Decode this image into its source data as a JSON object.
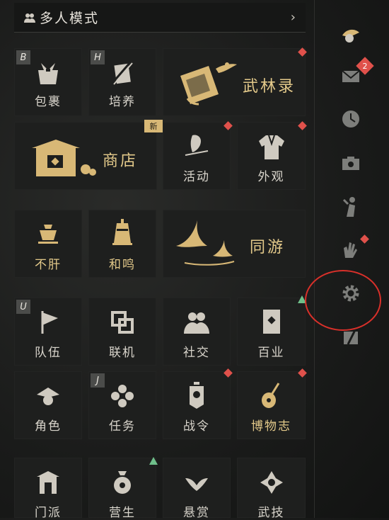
{
  "header": {
    "title": "多人模式",
    "arrow": "›"
  },
  "tiles": {
    "baoguo": {
      "label": "包裹",
      "key": "B"
    },
    "peiyang": {
      "label": "培养",
      "key": "H"
    },
    "wulinlu": {
      "label": "武林录"
    },
    "shangdian": {
      "label": "商店",
      "badge": "新"
    },
    "huodong": {
      "label": "活动"
    },
    "waiguan": {
      "label": "外观"
    },
    "bugan": {
      "label": "不肝"
    },
    "heming": {
      "label": "和鸣"
    },
    "tongyou": {
      "label": "同游"
    },
    "duiwu": {
      "label": "队伍",
      "key": "U"
    },
    "lianji": {
      "label": "联机"
    },
    "shejiao": {
      "label": "社交"
    },
    "baiye": {
      "label": "百业"
    },
    "juese": {
      "label": "角色"
    },
    "renwu": {
      "label": "任务",
      "key": "J"
    },
    "zhanling": {
      "label": "战令"
    },
    "bowuzhi": {
      "label": "博物志"
    },
    "r6a": {
      "label": "门派"
    },
    "r6b": {
      "label": "营生"
    },
    "r6c": {
      "label": "悬赏"
    },
    "r6d": {
      "label": "武技"
    }
  },
  "sidebar": {
    "mail_count": "2"
  },
  "colors": {
    "accent_gold": "#e3c98a",
    "red_dot": "#e0514b",
    "green_tri": "#6fbf8a",
    "annotation": "#d9302a"
  }
}
